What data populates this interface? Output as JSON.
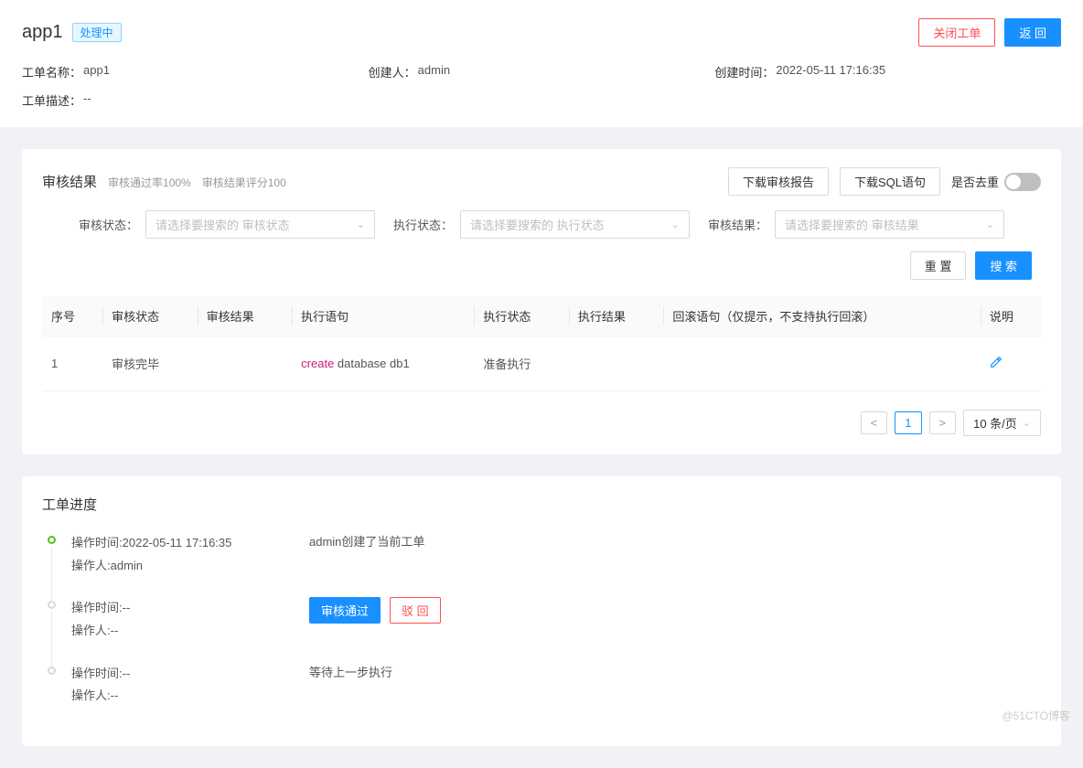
{
  "header": {
    "title": "app1",
    "status_tag": "处理中",
    "close_btn": "关闭工单",
    "back_btn": "返 回",
    "fields": {
      "name_label": "工单名称：",
      "name_value": "app1",
      "creator_label": "创建人：",
      "creator_value": "admin",
      "created_label": "创建时间：",
      "created_value": "2022-05-11 17:16:35",
      "desc_label": "工单描述：",
      "desc_value": "--"
    }
  },
  "audit": {
    "title": "审核结果",
    "pass_rate": "审核通过率100%",
    "score": "审核结果评分100",
    "download_report_btn": "下载审核报告",
    "download_sql_btn": "下载SQL语句",
    "dedup_label": "是否去重",
    "filters": {
      "audit_status_label": "审核状态：",
      "audit_status_placeholder": "请选择要搜索的 审核状态",
      "exec_status_label": "执行状态：",
      "exec_status_placeholder": "请选择要搜索的 执行状态",
      "audit_result_label": "审核结果：",
      "audit_result_placeholder": "请选择要搜索的 审核结果"
    },
    "reset_btn": "重 置",
    "search_btn": "搜 索",
    "columns": {
      "seq": "序号",
      "audit_status": "审核状态",
      "audit_result": "审核结果",
      "exec_sql": "执行语句",
      "exec_status": "执行状态",
      "exec_result": "执行结果",
      "rollback": "回滚语句（仅提示，不支持执行回滚）",
      "desc": "说明"
    },
    "rows": [
      {
        "seq": "1",
        "audit_status": "审核完毕",
        "audit_result": "",
        "sql_kw": "create",
        "sql_rest": " database db1",
        "exec_status": "准备执行",
        "exec_result": "",
        "rollback": "",
        "desc": ""
      }
    ],
    "pagination": {
      "current": "1",
      "page_size": "10 条/页"
    }
  },
  "progress": {
    "title": "工单进度",
    "approve_btn": "审核通过",
    "reject_btn": "驳 回",
    "items": [
      {
        "done": true,
        "time_label": "操作时间:",
        "time_value": "2022-05-11 17:16:35",
        "operator_label": "操作人:",
        "operator_value": "admin",
        "content": "admin创建了当前工单",
        "actions": false
      },
      {
        "done": false,
        "time_label": "操作时间:",
        "time_value": "--",
        "operator_label": "操作人:",
        "operator_value": "--",
        "content": "",
        "actions": true
      },
      {
        "done": false,
        "time_label": "操作时间:",
        "time_value": "--",
        "operator_label": "操作人:",
        "operator_value": "--",
        "content": "等待上一步执行",
        "actions": false
      }
    ]
  },
  "watermark": "@51CTO博客"
}
